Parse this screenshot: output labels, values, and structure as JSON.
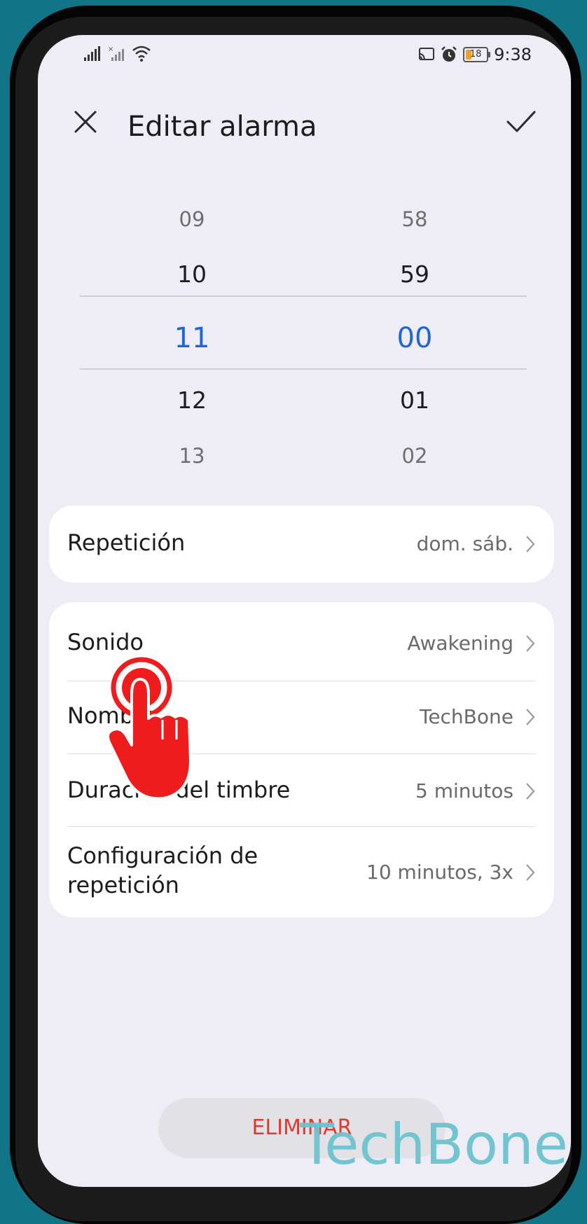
{
  "status_bar": {
    "time": "9:38",
    "battery": "18"
  },
  "header": {
    "title": "Editar alarma"
  },
  "picker": {
    "hours": [
      "09",
      "10",
      "11",
      "12",
      "13"
    ],
    "minutes": [
      "58",
      "59",
      "00",
      "01",
      "02"
    ]
  },
  "repeat": {
    "label": "Repetición",
    "value": "dom. sáb."
  },
  "settings": [
    {
      "label": "Sonido",
      "value": "Awakening"
    },
    {
      "label": "Nombre",
      "value": "TechBone"
    },
    {
      "label": "Duración del timbre",
      "value": "5 minutos"
    },
    {
      "label_line1": "Configuración de",
      "label_line2": "repetición",
      "value": "10 minutos, 3x"
    }
  ],
  "delete_label": "ELIMINAR",
  "watermark": "TechBone",
  "colors": {
    "accent": "#1f66d6",
    "danger": "#e03a30",
    "background": "#127487",
    "tap_indicator": "#ee1c1c"
  }
}
